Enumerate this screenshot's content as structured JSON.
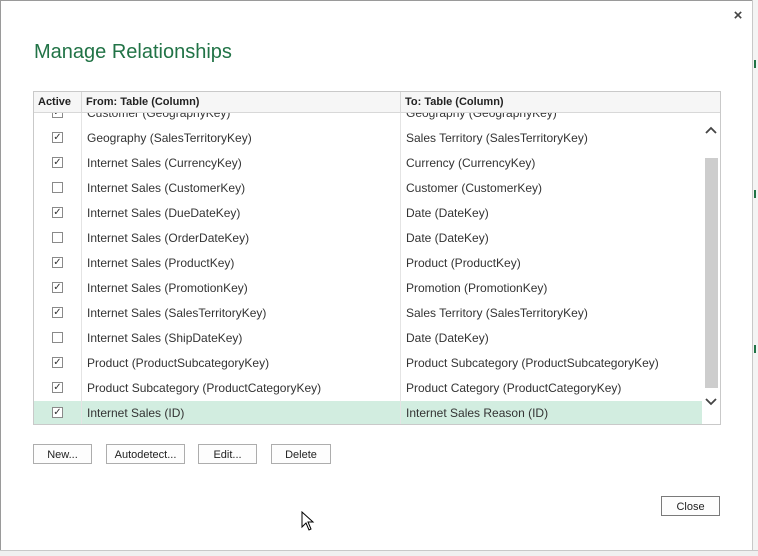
{
  "dialog": {
    "title": "Manage Relationships",
    "close_glyph": "×"
  },
  "table": {
    "headers": {
      "active": "Active",
      "from": "From: Table (Column)",
      "to": "To: Table (Column)"
    },
    "rows": [
      {
        "active": true,
        "from": "Customer (GeographyKey)",
        "to": "Geography (GeographyKey)"
      },
      {
        "active": true,
        "from": "Geography (SalesTerritoryKey)",
        "to": "Sales Territory (SalesTerritoryKey)"
      },
      {
        "active": true,
        "from": "Internet Sales (CurrencyKey)",
        "to": "Currency (CurrencyKey)"
      },
      {
        "active": false,
        "from": "Internet Sales (CustomerKey)",
        "to": "Customer (CustomerKey)"
      },
      {
        "active": true,
        "from": "Internet Sales (DueDateKey)",
        "to": "Date (DateKey)"
      },
      {
        "active": false,
        "from": "Internet Sales (OrderDateKey)",
        "to": "Date (DateKey)"
      },
      {
        "active": true,
        "from": "Internet Sales (ProductKey)",
        "to": "Product (ProductKey)"
      },
      {
        "active": true,
        "from": "Internet Sales (PromotionKey)",
        "to": "Promotion (PromotionKey)"
      },
      {
        "active": true,
        "from": "Internet Sales (SalesTerritoryKey)",
        "to": "Sales Territory (SalesTerritoryKey)"
      },
      {
        "active": false,
        "from": "Internet Sales (ShipDateKey)",
        "to": "Date (DateKey)"
      },
      {
        "active": true,
        "from": "Product (ProductSubcategoryKey)",
        "to": "Product Subcategory (ProductSubcategoryKey)"
      },
      {
        "active": true,
        "from": "Product Subcategory (ProductCategoryKey)",
        "to": "Product Category (ProductCategoryKey)"
      },
      {
        "active": true,
        "from": "Internet Sales (ID)",
        "to": "Internet Sales Reason (ID)",
        "selected": true
      }
    ]
  },
  "buttons": {
    "new": "New...",
    "autodetect": "Autodetect...",
    "edit": "Edit...",
    "delete": "Delete",
    "close": "Close"
  },
  "scrollbar": {
    "up_icon": "chevron-up-icon",
    "down_icon": "chevron-down-icon"
  },
  "colors": {
    "accent": "#217346",
    "selected_row": "#d2ede0"
  }
}
